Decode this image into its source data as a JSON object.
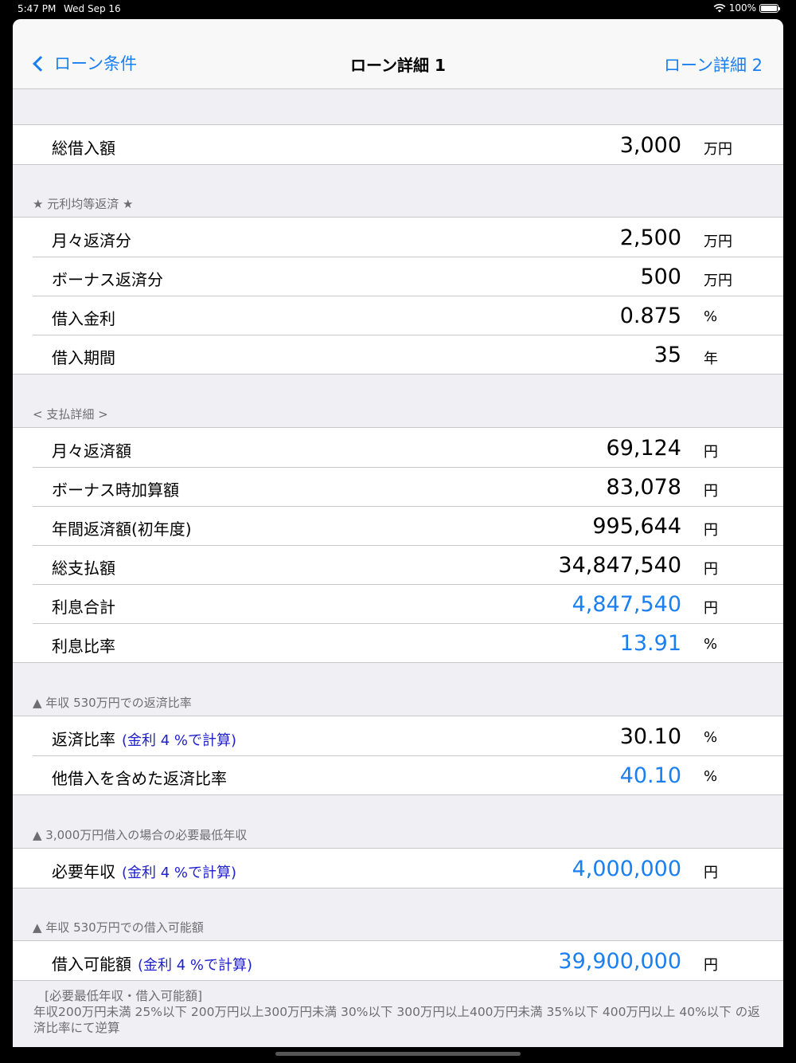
{
  "status": {
    "time": "5:47 PM",
    "date": "Wed Sep 16",
    "battery": "100%"
  },
  "nav": {
    "back_label": "ローン条件",
    "title": "ローン詳細 1",
    "next_label": "ローン詳細 2"
  },
  "colors": {
    "accent": "#1a7ff0",
    "note": "#2020cc",
    "header_text": "#6d6d72"
  },
  "total": {
    "rows": [
      {
        "label": "総借入額",
        "value": "3,000",
        "unit": "万円"
      }
    ]
  },
  "repayment": {
    "header": "★ 元利均等返済 ★",
    "rows": [
      {
        "label": "月々返済分",
        "value": "2,500",
        "unit": "万円"
      },
      {
        "label": "ボーナス返済分",
        "value": "500",
        "unit": "万円"
      },
      {
        "label": "借入金利",
        "value": "0.875",
        "unit": "%"
      },
      {
        "label": "借入期間",
        "value": "35",
        "unit": "年"
      }
    ]
  },
  "payment": {
    "header": "< 支払詳細 >",
    "rows": [
      {
        "label": "月々返済額",
        "value": "69,124",
        "unit": "円"
      },
      {
        "label": "ボーナス時加算額",
        "value": "83,078",
        "unit": "円"
      },
      {
        "label": "年間返済額(初年度)",
        "value": "995,644",
        "unit": "円"
      },
      {
        "label": "総支払額",
        "value": "34,847,540",
        "unit": "円"
      },
      {
        "label": "利息合計",
        "value": "4,847,540",
        "unit": "円",
        "blue": true
      },
      {
        "label": "利息比率",
        "value": "13.91",
        "unit": "%",
        "blue": true
      }
    ]
  },
  "ratio": {
    "header": "▲ 年収 530万円での返済比率",
    "rows": [
      {
        "label": "返済比率",
        "note": "(金利 4 %で計算)",
        "value": "30.10",
        "unit": "%"
      },
      {
        "label": "他借入を含めた返済比率",
        "value": "40.10",
        "unit": "%",
        "blue": true
      }
    ]
  },
  "income": {
    "header": "▲ 3,000万円借入の場合の必要最低年収",
    "rows": [
      {
        "label": "必要年収",
        "note": "(金利 4 %で計算)",
        "value": "4,000,000",
        "unit": "円",
        "blue": true
      }
    ]
  },
  "borrowable": {
    "header": "▲ 年収 530万円での借入可能額",
    "rows": [
      {
        "label": "借入可能額",
        "note": "(金利 4 %で計算)",
        "value": "39,900,000",
        "unit": "円",
        "blue": true
      }
    ]
  },
  "footnote": {
    "line1": "[必要最低年収・借入可能額]",
    "line2": "年収200万円未満 25%以下 200万円以上300万円未満 30%以下 300万円以上400万円未満 35%以下 400万円以上 40%以下 の返済比率にて逆算"
  }
}
